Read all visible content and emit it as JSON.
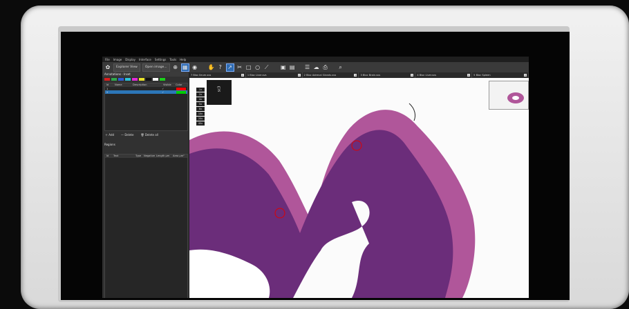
{
  "menu": [
    "File",
    "Image",
    "Display",
    "Interface",
    "Settings",
    "Tools",
    "Help"
  ],
  "toolbar": {
    "explorer_view": "Explorer View",
    "open_image": "Open image...",
    "icons": [
      "hand-icon",
      "lasso-icon",
      "pointer-icon",
      "scissors-icon",
      "rectangle-icon",
      "ellipse-icon",
      "ruler-icon",
      "save-icon",
      "save-as-icon",
      "settings-sliders-icon",
      "cloud-icon",
      "print-icon",
      "search-icon"
    ]
  },
  "left_panel": {
    "annotations_title": "Annotations - Inset",
    "swatch_colors": [
      "#d81e1e",
      "#2ea84b",
      "#2e5bd3",
      "#2ac2d6",
      "#e22ad6",
      "#e8e12a",
      "#111111",
      "#ffffff",
      "#1ccf1c"
    ],
    "table_headers": [
      "Id",
      "Name",
      "Description",
      "Visible",
      "Color"
    ],
    "rows": [
      {
        "id": "1",
        "color": "#ff0000"
      },
      {
        "id": "2",
        "color": "#00cc00"
      }
    ],
    "actions": {
      "add": "Add",
      "delete": "Delete",
      "delete_all": "Delete all"
    },
    "regions_title": "Regions",
    "regions_headers": [
      "Id",
      "Text",
      "Type",
      "Negative",
      "Length µm",
      "Area µm²"
    ]
  },
  "tabs": [
    {
      "label": "7 Bloc Ileum.svs"
    },
    {
      "label": "1 Bloc Liver.svs"
    },
    {
      "label": "2 Bloc Adrenal Glands.svs"
    },
    {
      "label": "3 Bloc Brain.svs"
    },
    {
      "label": "4 Bloc Liver.svs"
    },
    {
      "label": "5 Bloc Spleen"
    }
  ],
  "zoom_levels": [
    "1x",
    "2x",
    "4x",
    "5x",
    "8x",
    "10x",
    "20x",
    "40x"
  ],
  "slide_label": "sc3"
}
